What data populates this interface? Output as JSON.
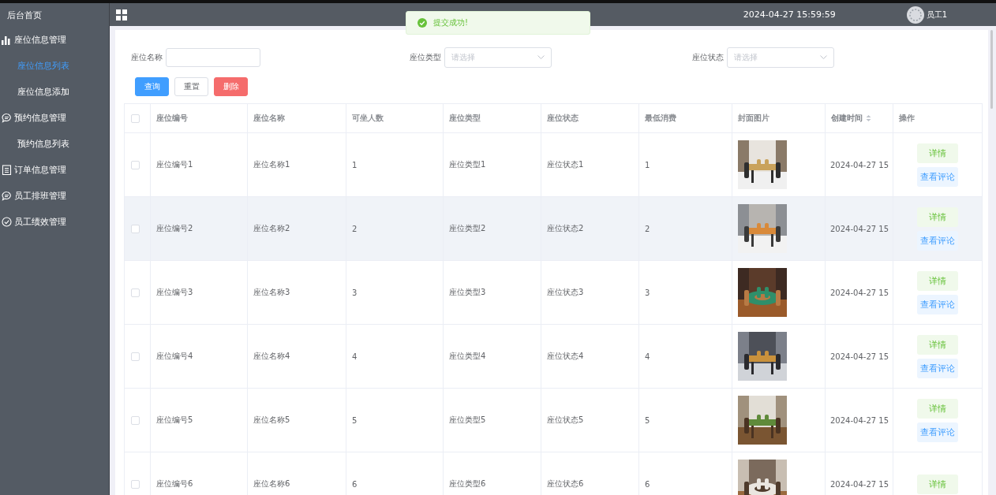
{
  "sidebar": {
    "items": [
      {
        "label": "后台首页",
        "kind": "plain",
        "selected": false
      },
      {
        "label": "座位信息管理",
        "kind": "chart",
        "selected": false,
        "children": [
          {
            "label": "座位信息列表",
            "selected": true
          },
          {
            "label": "座位信息添加",
            "selected": false
          }
        ]
      },
      {
        "label": "预约信息管理",
        "kind": "chat",
        "selected": false,
        "children": [
          {
            "label": "预约信息列表",
            "selected": false
          }
        ]
      },
      {
        "label": "订单信息管理",
        "kind": "doc",
        "selected": false
      },
      {
        "label": "员工排班管理",
        "kind": "chat",
        "selected": false
      },
      {
        "label": "员工绩效管理",
        "kind": "check",
        "selected": false
      }
    ]
  },
  "header": {
    "datetime": "2024-04-27 15:59:59",
    "user": "员工1"
  },
  "toast": {
    "kind": "success",
    "message": "提交成功!"
  },
  "filters": [
    {
      "label": "座位名称",
      "kind": "input"
    },
    {
      "label": "座位类型",
      "kind": "select",
      "placeholder": "请选择"
    },
    {
      "label": "座位状态",
      "kind": "select",
      "placeholder": "请选择"
    }
  ],
  "buttons": [
    {
      "label": "查询",
      "kind": "primary"
    },
    {
      "label": "重置",
      "kind": "default"
    },
    {
      "label": "删除",
      "kind": "danger"
    }
  ],
  "table": {
    "select_all_checked": false,
    "columns": [
      {
        "label": "座位编号",
        "sortable": false
      },
      {
        "label": "座位名称",
        "sortable": false
      },
      {
        "label": "可坐人数",
        "sortable": false
      },
      {
        "label": "座位类型",
        "sortable": false
      },
      {
        "label": "座位状态",
        "sortable": false
      },
      {
        "label": "最低消费",
        "sortable": false
      },
      {
        "label": "封面图片",
        "sortable": false
      },
      {
        "label": "创建时间",
        "sortable": true
      },
      {
        "label": "操作",
        "sortable": false
      }
    ],
    "rows": [
      {
        "checked": false,
        "highlighted": false,
        "cells": [
          "座位编号1",
          "座位名称1",
          "1",
          "座位类型1",
          "座位状态1",
          "1"
        ],
        "image": {
          "kind": "picture"
        },
        "created": "2024-04-27 15",
        "actions": [
          "详情",
          "查看评论"
        ]
      },
      {
        "checked": false,
        "highlighted": true,
        "cells": [
          "座位编号2",
          "座位名称2",
          "2",
          "座位类型2",
          "座位状态2",
          "2"
        ],
        "image": {
          "kind": "picture"
        },
        "created": "2024-04-27 15",
        "actions": [
          "详情",
          "查看评论"
        ]
      },
      {
        "checked": false,
        "highlighted": false,
        "cells": [
          "座位编号3",
          "座位名称3",
          "3",
          "座位类型3",
          "座位状态3",
          "3"
        ],
        "image": {
          "kind": "picture"
        },
        "created": "2024-04-27 15",
        "actions": [
          "详情",
          "查看评论"
        ]
      },
      {
        "checked": false,
        "highlighted": false,
        "cells": [
          "座位编号4",
          "座位名称4",
          "4",
          "座位类型4",
          "座位状态4",
          "4"
        ],
        "image": {
          "kind": "picture"
        },
        "created": "2024-04-27 15",
        "actions": [
          "详情",
          "查看评论"
        ]
      },
      {
        "checked": false,
        "highlighted": false,
        "cells": [
          "座位编号5",
          "座位名称5",
          "5",
          "座位类型5",
          "座位状态5",
          "5"
        ],
        "image": {
          "kind": "picture"
        },
        "created": "2024-04-27 15",
        "actions": [
          "详情",
          "查看评论"
        ]
      },
      {
        "checked": false,
        "highlighted": false,
        "cells": [
          "座位编号6",
          "座位名称6",
          "6",
          "座位类型6",
          "座位状态6",
          "6"
        ],
        "image": {
          "kind": "picture"
        },
        "created": "2024-04-27 15",
        "actions": [
          "详情"
        ]
      }
    ]
  }
}
